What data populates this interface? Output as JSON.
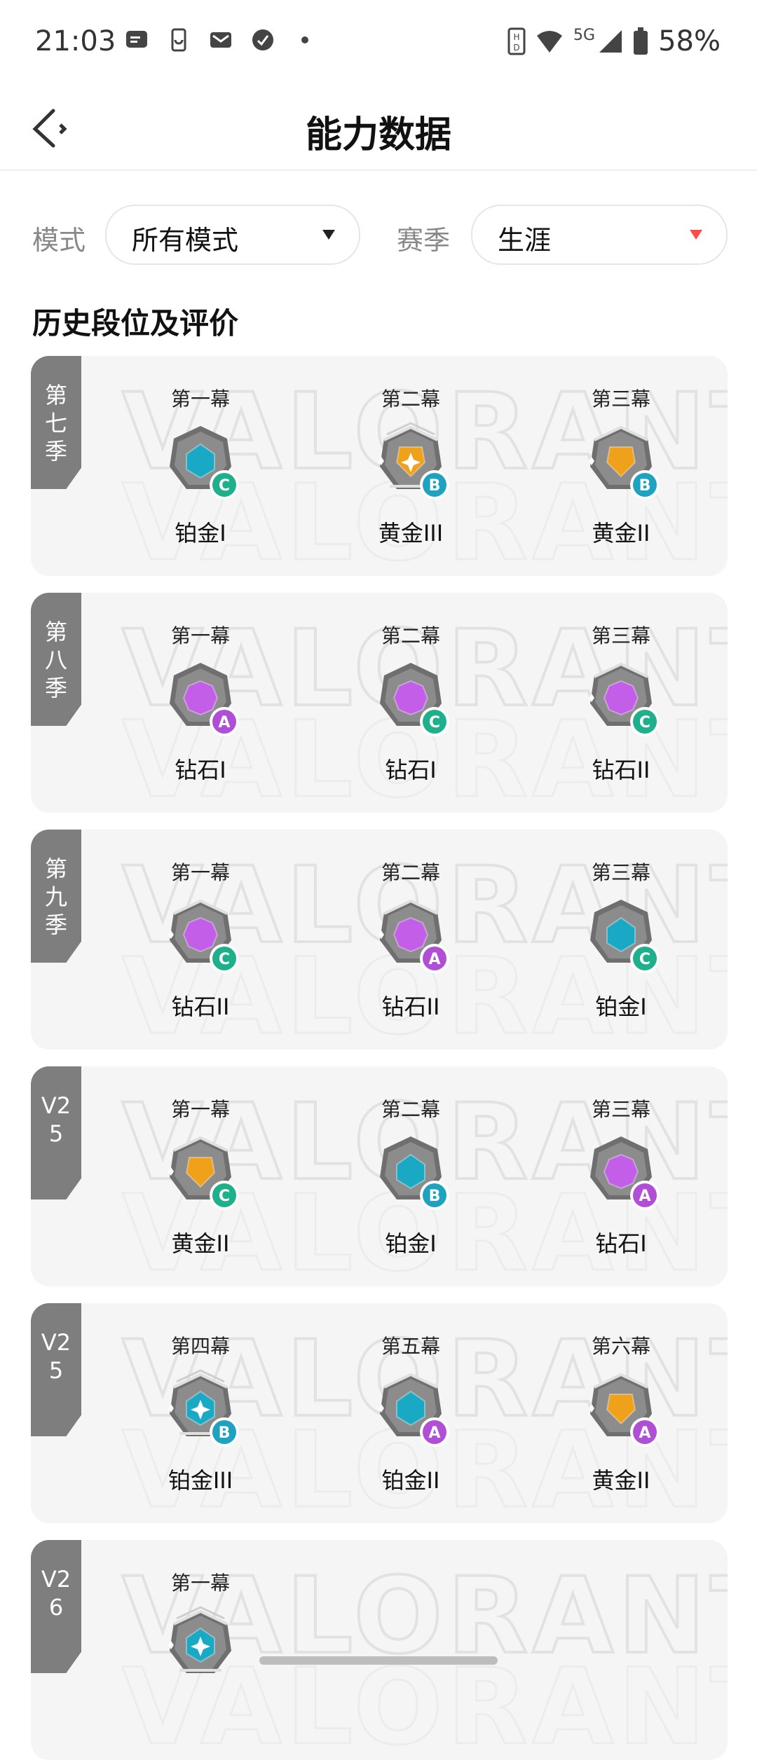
{
  "status_bar": {
    "time": "21:03",
    "network": "5G",
    "battery": "58%"
  },
  "header": {
    "title": "能力数据",
    "back_icon": "back-arrow-icon"
  },
  "filters": {
    "mode_label": "模式",
    "mode_value": "所有模式",
    "season_label": "赛季",
    "season_value": "生涯"
  },
  "section_title": "历史段位及评价",
  "watermark": "VALORANT",
  "tier_colors": {
    "platinum": "#1aa9c4",
    "gold": "#f0a11c",
    "diamond": "#c35ee8"
  },
  "grade_colors": {
    "A": "#b04fd6",
    "B": "#1da2c0",
    "C": "#1db08a"
  },
  "seasons": [
    {
      "label": "第七季",
      "acts": [
        {
          "title": "第一幕",
          "rank": "铂金I",
          "tier": "platinum",
          "level": 1,
          "grade": "C"
        },
        {
          "title": "第二幕",
          "rank": "黄金III",
          "tier": "gold",
          "level": 3,
          "grade": "B"
        },
        {
          "title": "第三幕",
          "rank": "黄金II",
          "tier": "gold",
          "level": 2,
          "grade": "B"
        }
      ]
    },
    {
      "label": "第八季",
      "acts": [
        {
          "title": "第一幕",
          "rank": "钻石I",
          "tier": "diamond",
          "level": 1,
          "grade": "A"
        },
        {
          "title": "第二幕",
          "rank": "钻石I",
          "tier": "diamond",
          "level": 1,
          "grade": "C"
        },
        {
          "title": "第三幕",
          "rank": "钻石II",
          "tier": "diamond",
          "level": 2,
          "grade": "C"
        }
      ]
    },
    {
      "label": "第九季",
      "acts": [
        {
          "title": "第一幕",
          "rank": "钻石II",
          "tier": "diamond",
          "level": 2,
          "grade": "C"
        },
        {
          "title": "第二幕",
          "rank": "钻石II",
          "tier": "diamond",
          "level": 2,
          "grade": "A"
        },
        {
          "title": "第三幕",
          "rank": "铂金I",
          "tier": "platinum",
          "level": 1,
          "grade": "C"
        }
      ]
    },
    {
      "label": "V25",
      "acts": [
        {
          "title": "第一幕",
          "rank": "黄金II",
          "tier": "gold",
          "level": 2,
          "grade": "C"
        },
        {
          "title": "第二幕",
          "rank": "铂金I",
          "tier": "platinum",
          "level": 1,
          "grade": "B"
        },
        {
          "title": "第三幕",
          "rank": "钻石I",
          "tier": "diamond",
          "level": 1,
          "grade": "A"
        }
      ]
    },
    {
      "label": "V25",
      "acts": [
        {
          "title": "第四幕",
          "rank": "铂金III",
          "tier": "platinum",
          "level": 3,
          "grade": "B"
        },
        {
          "title": "第五幕",
          "rank": "铂金II",
          "tier": "platinum",
          "level": 2,
          "grade": "A"
        },
        {
          "title": "第六幕",
          "rank": "黄金II",
          "tier": "gold",
          "level": 2,
          "grade": "A"
        }
      ]
    },
    {
      "label": "V26",
      "acts": [
        {
          "title": "第一幕",
          "rank": "",
          "tier": "platinum",
          "level": 3,
          "grade": ""
        }
      ]
    }
  ]
}
